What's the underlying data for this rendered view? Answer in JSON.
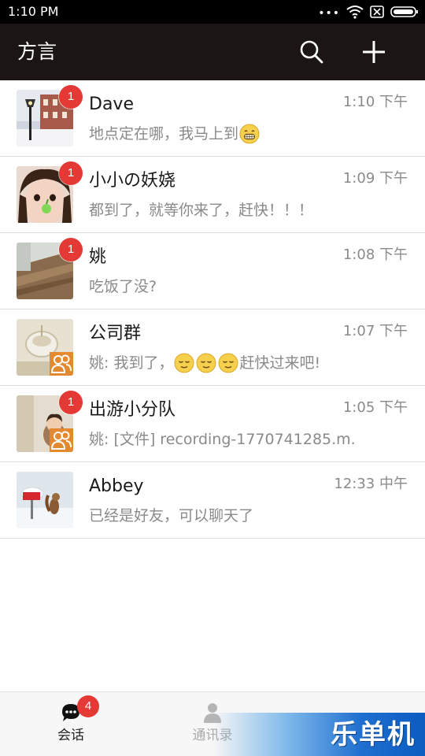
{
  "status_bar": {
    "time": "1:10 PM",
    "icons": [
      "more-dots-icon",
      "wifi-icon",
      "sim-off-icon",
      "battery-icon"
    ]
  },
  "app_bar": {
    "title": "方言",
    "search_icon": "search-icon",
    "add_icon": "plus-icon"
  },
  "conversations": [
    {
      "name": "Dave",
      "time": "1:10 下午",
      "preview": "地点定在哪，我马上到",
      "emoji": "grin-emoji",
      "unread": "1",
      "is_group": false
    },
    {
      "name": "小小の妖娆",
      "time": "1:09 下午",
      "preview": "都到了，就等你来了，赶快！！！",
      "unread": "1",
      "is_group": false
    },
    {
      "name": "姚",
      "time": "1:08 下午",
      "preview": "吃饭了没?",
      "unread": "1",
      "is_group": false
    },
    {
      "name": "公司群",
      "time": "1:07 下午",
      "preview_prefix": "姚: 我到了，",
      "emoji": "relieved-emoji",
      "preview_suffix": "赶快过来吧!",
      "unread": "",
      "is_group": true
    },
    {
      "name": "出游小分队",
      "time": "1:05 下午",
      "preview": "姚: [文件] recording-1770741285.m...",
      "unread": "1",
      "is_group": true
    },
    {
      "name": "Abbey",
      "time": "12:33 中午",
      "preview": "已经是好友，可以聊天了",
      "unread": "",
      "is_group": false
    }
  ],
  "bottom_nav": {
    "chat_label": "会话",
    "chat_badge": "4",
    "contacts_label": "通讯录"
  },
  "watermark": "乐单机",
  "colors": {
    "app_bar": "#1b1614",
    "badge": "#e53935",
    "group_icon": "#e3892f",
    "secondary_text": "#8a8a8a"
  }
}
